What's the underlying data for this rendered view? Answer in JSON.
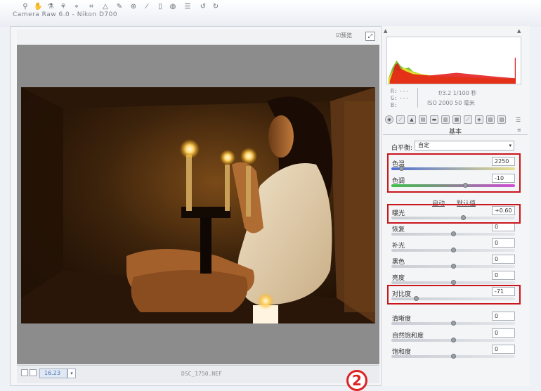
{
  "window": {
    "title": "Camera Raw 6.0 - Nikon D700"
  },
  "toolbar": {
    "tools": [
      "zoom-tool",
      "hand-tool",
      "white-balance-tool",
      "color-sampler-tool",
      "target-adjustment-tool",
      "crop-tool",
      "straighten-tool",
      "spot-removal-tool",
      "red-eye-tool",
      "adjustment-brush-tool",
      "graduated-filter-tool",
      "open-preferences",
      "rotate-ccw",
      "rotate-cw"
    ],
    "preview_label": "预览"
  },
  "status": {
    "zoom": "16.23",
    "filename": "DSC_1750.NEF",
    "step_number": "2"
  },
  "info": {
    "r": "R:",
    "g": "G:",
    "b": "B:",
    "r_val": "---",
    "g_val": "---",
    "aperture_shutter": "f/3.2   1/100 秒",
    "iso_lens": "ISO 2000   50 毫米"
  },
  "panel": {
    "section_title": "基本",
    "white_balance_label": "白平衡:",
    "white_balance_value": "自定",
    "auto_label": "自动",
    "default_label": "默认值",
    "sliders": [
      {
        "key": "temperature",
        "label": "色温",
        "value": "2250",
        "pos": 0.08,
        "track": "temp"
      },
      {
        "key": "tint",
        "label": "色调",
        "value": "-10",
        "pos": 0.6,
        "track": "tint"
      },
      {
        "key": "exposure",
        "label": "曝光",
        "value": "+0.60",
        "pos": 0.58,
        "track": "gray"
      },
      {
        "key": "recovery",
        "label": "恢复",
        "value": "0",
        "pos": 0.5,
        "track": "gray"
      },
      {
        "key": "fill",
        "label": "补光",
        "value": "0",
        "pos": 0.5,
        "track": "gray"
      },
      {
        "key": "blacks",
        "label": "黑色",
        "value": "0",
        "pos": 0.5,
        "track": "gray"
      },
      {
        "key": "brightness",
        "label": "亮度",
        "value": "0",
        "pos": 0.5,
        "track": "gray"
      },
      {
        "key": "contrast",
        "label": "对比度",
        "value": "-71",
        "pos": 0.2,
        "track": "gray"
      },
      {
        "key": "clarity",
        "label": "清晰度",
        "value": "0",
        "pos": 0.5,
        "track": "gray"
      },
      {
        "key": "vibrance",
        "label": "自然饱和度",
        "value": "0",
        "pos": 0.5,
        "track": "gray"
      },
      {
        "key": "saturation",
        "label": "饱和度",
        "value": "0",
        "pos": 0.5,
        "track": "gray"
      }
    ]
  },
  "colors": {
    "highlight_box": "#c9161d",
    "zoom_text": "#4a74b8"
  }
}
